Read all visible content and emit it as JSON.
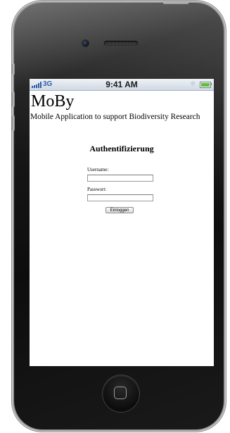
{
  "status_bar": {
    "network": "3G",
    "time": "9:41 AM",
    "bluetooth_icon": "bluetooth-icon",
    "battery_level": 1.0
  },
  "app": {
    "title": "MoBy",
    "subtitle": "Mobile Application to support Biodiversity Research"
  },
  "login": {
    "heading": "Authentifizierung",
    "username_label": "Username:",
    "username_value": "",
    "password_label": "Passwort:",
    "password_value": "",
    "submit_label": "Einloggen"
  },
  "colors": {
    "network_blue": "#2d5fa8",
    "battery_green": "#5bc236"
  }
}
